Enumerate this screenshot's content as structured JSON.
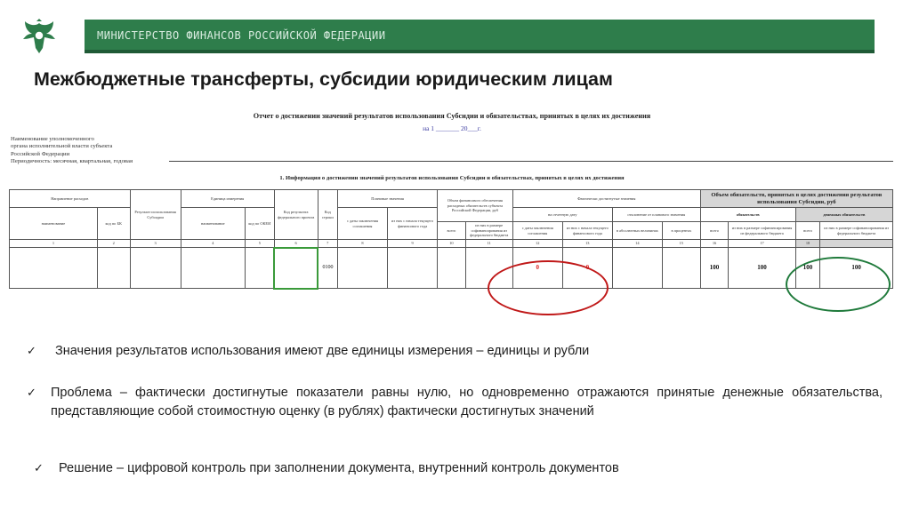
{
  "header": {
    "org_name": "МИНИСТЕРСТВО ФИНАНСОВ РОССИЙСКОЙ ФЕДЕРАЦИИ",
    "emblem_icon": "double-headed-eagle-icon",
    "bar_color": "#2e7d4b"
  },
  "slide": {
    "title": "Межбюджетные трансферты, субсидии юридическим лицам"
  },
  "document": {
    "title": "Отчет о достижении значений результатов использования  Субсидии и обязательствах, принятых в целях их достижения",
    "date_line": "на 1 _______ 20___г.",
    "left_lines": [
      "Наименование уполномоченного",
      "органа исполнительной власти субъекта",
      "Российской Федерации",
      "Периодичность: месячная, квартальная, годовая"
    ],
    "section_title": "1. Информация о достижении значений результатов использования Субсидии и обязательствах, принятых в целях их достижения",
    "headers": {
      "direction": "Направление расходов",
      "name": "наименование",
      "bk_code": "код по БК",
      "result": "Результат использования Субсидии",
      "unit": "Единица измерения",
      "unit_name": "наименование",
      "okei": "код по ОКЕИ",
      "result_code": "Код результата федерального проекта",
      "row_code": "Код строки",
      "plan_values": "Плановые значения",
      "plan_agreement": "с даты заключения соглашения",
      "plan_year": "из них с начала текущего финансового года",
      "financing": "Объем финансового обеспечения расходных обязательств субъекта Российской Федерации, руб",
      "fin_total": "всего",
      "fin_federal": "из них в размере софинансирования из федерального бюджета",
      "actual": "Фактически достигнутые значения",
      "actual_date": "на отчетную дату",
      "actual_agreement": "с даты заключения соглашения",
      "actual_year": "из них с начала текущего финансового года",
      "deviation": "отклонение от планового значения",
      "deviation_abs": "в абсолютных величинах",
      "deviation_pct": "в процентах",
      "obligations": "Объем обязательств, принятых в целях достижения результатов использования Субсидии, руб",
      "obl_group": "обязательств",
      "obl_total": "всего",
      "obl_federal": "из них в размере софинансирования из федерального бюджета",
      "money_group": "денежных обязательств",
      "money_total": "всего",
      "money_federal": "из них в размере софинансирования из федерального бюджета"
    },
    "column_numbers": [
      "1",
      "2",
      "3",
      "4",
      "5",
      "6",
      "7",
      "8",
      "9",
      "10",
      "11",
      "12",
      "13",
      "14",
      "15",
      "16",
      "17",
      "18"
    ],
    "row": {
      "row_code": "0100",
      "actual_agreement": "0",
      "actual_year": "0",
      "obl_total": "100",
      "obl_federal": "100",
      "money_total": "100",
      "money_federal": "100"
    }
  },
  "bullets": [
    "Значения результатов использования имеют две единицы измерения – единицы и рубли",
    "Проблема – фактически достигнутые показатели равны нулю, но одновременно отражаются принятые денежные обязательства, представляющие собой стоимостную оценку (в рублях) фактически достигнутых значений",
    "Решение – цифровой контроль при заполнении документа, внутренний контроль документов"
  ],
  "colors": {
    "red_highlight": "#c01818",
    "green_highlight": "#1f7a3b"
  }
}
